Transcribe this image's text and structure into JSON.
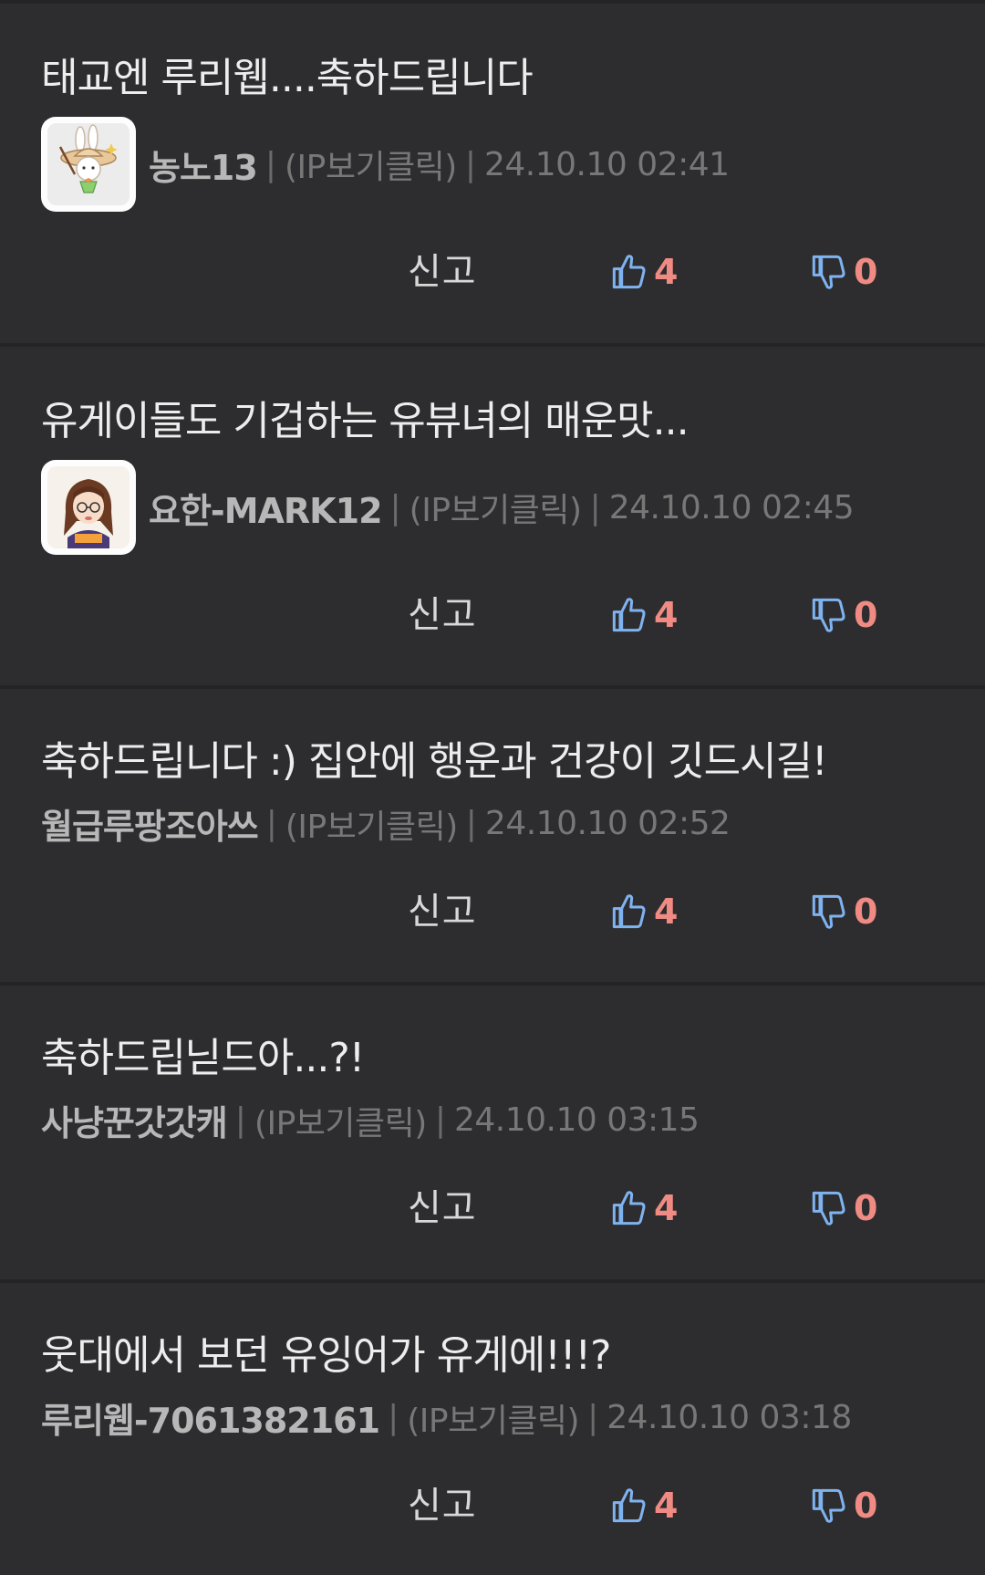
{
  "comments": [
    {
      "text": "태교엔 루리웹....축하드립니다",
      "nickname": "농노13",
      "ip": "(IP보기클릭)",
      "date": "24.10.10 02:41",
      "has_avatar": true,
      "avatar": "rabbit-avatar-icon",
      "report": "신고",
      "upvotes": "4",
      "downvotes": "0"
    },
    {
      "text": "유게이들도 기겁하는 유뷰녀의 매운맛...",
      "nickname": "요한-MARK12",
      "ip": "(IP보기클릭)",
      "date": "24.10.10 02:45",
      "has_avatar": true,
      "avatar": "anime-girl-avatar-icon",
      "report": "신고",
      "upvotes": "4",
      "downvotes": "0"
    },
    {
      "text": "축하드립니다 :) 집안에 행운과 건강이 깃드시길!",
      "nickname": "월급루팡조아쓰",
      "ip": "(IP보기클릭)",
      "date": "24.10.10 02:52",
      "has_avatar": false,
      "report": "신고",
      "upvotes": "4",
      "downvotes": "0"
    },
    {
      "text": "축하드립닏드아...?!",
      "nickname": "사냥꾼갓갓캐",
      "ip": "(IP보기클릭)",
      "date": "24.10.10 03:15",
      "has_avatar": false,
      "report": "신고",
      "upvotes": "4",
      "downvotes": "0"
    },
    {
      "text": "웃대에서 보던 유잉어가 유게에!!!?",
      "nickname": "루리웹-7061382161",
      "ip": "(IP보기클릭)",
      "date": "24.10.10 03:18",
      "has_avatar": false,
      "report": "신고",
      "upvotes": "4",
      "downvotes": "0"
    }
  ],
  "colors": {
    "background": "#2d2d2f",
    "divider": "#242426",
    "vote_icon": "#7fb3f0",
    "vote_count": "#f08b84",
    "nickname": "#b7b7b7",
    "meta": "#777777"
  }
}
